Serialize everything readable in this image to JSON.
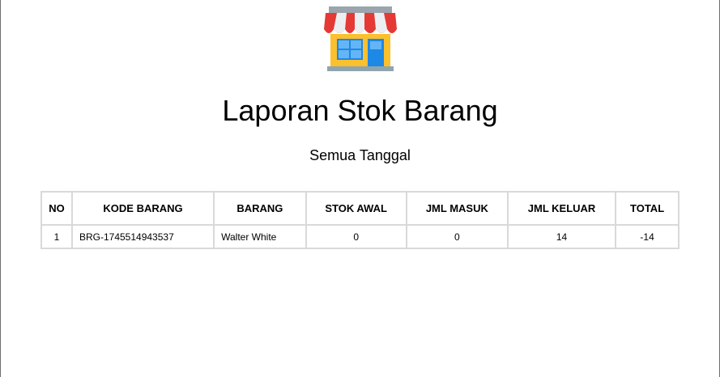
{
  "icon": "store-icon",
  "title": "Laporan Stok Barang",
  "subtitle": "Semua Tanggal",
  "table": {
    "headers": [
      "NO",
      "KODE BARANG",
      "BARANG",
      "STOK AWAL",
      "JML MASUK",
      "JML KELUAR",
      "TOTAL"
    ],
    "rows": [
      [
        "1",
        "BRG-1745514943537",
        "Walter White",
        "0",
        "0",
        "14",
        "-14"
      ]
    ]
  }
}
